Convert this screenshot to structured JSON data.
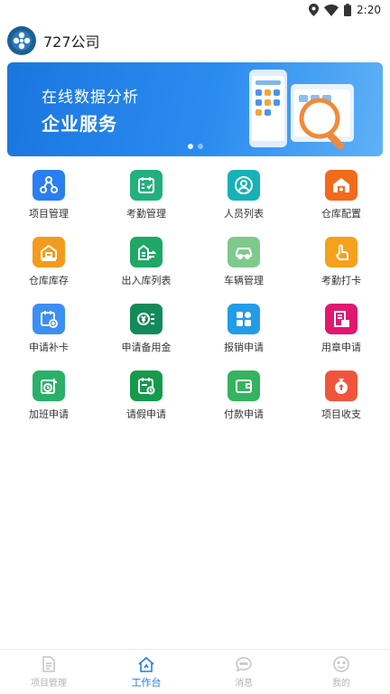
{
  "status_bar": {
    "time": "2:20"
  },
  "header": {
    "title": "727公司"
  },
  "banner": {
    "line1": "在线数据分析",
    "line2": "企业服务"
  },
  "grid": {
    "items": [
      {
        "label": "项目管理",
        "icon": "org-chart-icon",
        "color": "#2a7ff0"
      },
      {
        "label": "考勤管理",
        "icon": "calendar-check-icon",
        "color": "#22b07d"
      },
      {
        "label": "人员列表",
        "icon": "person-icon",
        "color": "#16b2b6"
      },
      {
        "label": "仓库配置",
        "icon": "warehouse-settings-icon",
        "color": "#f26a1b"
      },
      {
        "label": "仓库库存",
        "icon": "warehouse-icon",
        "color": "#f29b1d"
      },
      {
        "label": "出入库列表",
        "icon": "building-transfer-icon",
        "color": "#1fa765"
      },
      {
        "label": "车辆管理",
        "icon": "car-icon",
        "color": "#7fc98d"
      },
      {
        "label": "考勤打卡",
        "icon": "tap-finger-icon",
        "color": "#f5a11c"
      },
      {
        "label": "申请补卡",
        "icon": "calendar-add-icon",
        "color": "#3b8ff2"
      },
      {
        "label": "申请备用金",
        "icon": "money-list-icon",
        "color": "#138a5a"
      },
      {
        "label": "报销申请",
        "icon": "reimburse-grid-icon",
        "color": "#229ce8"
      },
      {
        "label": "用章申请",
        "icon": "seal-document-icon",
        "color": "#e0186f"
      },
      {
        "label": "加班申请",
        "icon": "overtime-clock-icon",
        "color": "#2bb06a"
      },
      {
        "label": "请假申请",
        "icon": "leave-calendar-icon",
        "color": "#159a4b"
      },
      {
        "label": "付款申请",
        "icon": "wallet-icon",
        "color": "#34b45f"
      },
      {
        "label": "项目收支",
        "icon": "money-bag-icon",
        "color": "#f0553c"
      }
    ]
  },
  "tabbar": {
    "items": [
      {
        "label": "项目管理",
        "icon": "document-icon",
        "active": false
      },
      {
        "label": "工作台",
        "icon": "workbench-icon",
        "active": true
      },
      {
        "label": "消息",
        "icon": "message-icon",
        "active": false
      },
      {
        "label": "我的",
        "icon": "profile-icon",
        "active": false
      }
    ]
  }
}
